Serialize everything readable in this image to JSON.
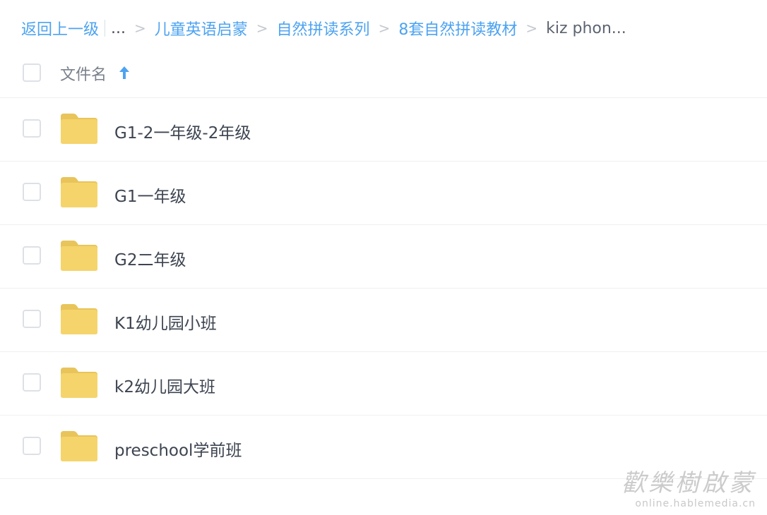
{
  "breadcrumb": {
    "back_label": "返回上一级",
    "ellipsis": "...",
    "separator": ">",
    "items": [
      "儿童英语启蒙",
      "自然拼读系列",
      "8套自然拼读教材"
    ],
    "current": "kiz phon..."
  },
  "header": {
    "column_label": "文件名",
    "sort_icon": "arrow-up-icon",
    "sort_direction": "ascending"
  },
  "files": [
    {
      "name": "G1-2一年级-2年级",
      "type": "folder"
    },
    {
      "name": "G1一年级",
      "type": "folder"
    },
    {
      "name": "G2二年级",
      "type": "folder"
    },
    {
      "name": "K1幼儿园小班",
      "type": "folder"
    },
    {
      "name": "k2幼儿园大班",
      "type": "folder"
    },
    {
      "name": "preschool学前班",
      "type": "folder"
    }
  ],
  "watermark": {
    "title": "歡樂樹啟蒙",
    "url": "online.hablemedia.cn"
  },
  "colors": {
    "link": "#4da3f0",
    "folder": "#f5d46b",
    "folder_tab": "#e8c45a",
    "text": "#3d4450",
    "divider": "#eef0f3"
  }
}
